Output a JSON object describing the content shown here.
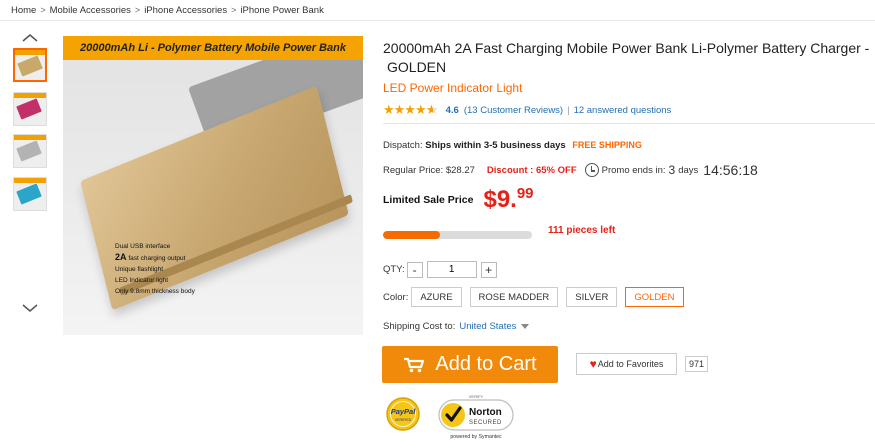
{
  "breadcrumb": [
    "Home",
    "Mobile Accessories",
    "iPhone Accessories",
    "iPhone Power Bank"
  ],
  "gallery": {
    "thumbnails": [
      {
        "name": "golden",
        "color": "#c9a96a"
      },
      {
        "name": "rose-madder",
        "color": "#c2306a"
      },
      {
        "name": "silver",
        "color": "#b3b3b3"
      },
      {
        "name": "azure",
        "color": "#2ba6c9"
      }
    ],
    "active_index": 0,
    "main_image": {
      "header_text": "20000mAh Li - Polymer Battery Mobile Power Bank",
      "features": [
        {
          "text": "Dual USB interface"
        },
        {
          "text": "2A",
          "suffix": " fast charging output"
        },
        {
          "text": "Unique flashlight"
        },
        {
          "text": "LED Indicator light"
        },
        {
          "text": "Only 9.8mm thickness body"
        }
      ]
    }
  },
  "product": {
    "title_line1": "20000mAh 2A Fast Charging Mobile Power Bank Li-Polymer Battery Charger -",
    "title_line2": "GOLDEN",
    "subtitle": "LED Power Indicator Light",
    "rating_stars": 4.6,
    "rating": "4.6",
    "reviews": "(13 Customer Reviews)",
    "divider": "|",
    "answered": "12 answered questions"
  },
  "dispatch": {
    "label": "Dispatch:",
    "value": "Ships within 3-5 business days",
    "free_shipping": "FREE SHIPPING"
  },
  "pricing": {
    "regular_label": "Regular Price: $28.27",
    "discount": "Discount : 65% OFF",
    "promo_label": "Promo ends in:",
    "days": "3",
    "days_label": "days",
    "timer": "14:56:18",
    "sale_label": "Limited Sale Price",
    "sale_price_main": "$9.",
    "sale_price_cents": "99"
  },
  "stock": {
    "sold_fraction": 0.38,
    "pieces_left": "111 pieces left"
  },
  "quantity": {
    "label": "QTY:",
    "minus": "-",
    "plus": "+",
    "value": "1"
  },
  "color": {
    "label": "Color:",
    "options": [
      "AZURE",
      "ROSE MADDER",
      "SILVER",
      "GOLDEN"
    ],
    "selected": "GOLDEN"
  },
  "shipping": {
    "label": "Shipping Cost to:",
    "country": "United States"
  },
  "actions": {
    "add_to_cart": "Add to Cart",
    "add_to_favorites": "Add to Favorites",
    "favorites_count": "971"
  },
  "badges": {
    "paypal_top": "PayPal",
    "paypal_bottom": "VERIFIED",
    "norton_verify": "VERIFY",
    "norton_name": "Norton",
    "norton_secured": "SECURED",
    "norton_powered": "powered by Symantec"
  },
  "colors": {
    "accent_orange": "#f18a0a",
    "price_red": "#e62117",
    "link_blue": "#2370b5",
    "star": "#f3a200"
  }
}
